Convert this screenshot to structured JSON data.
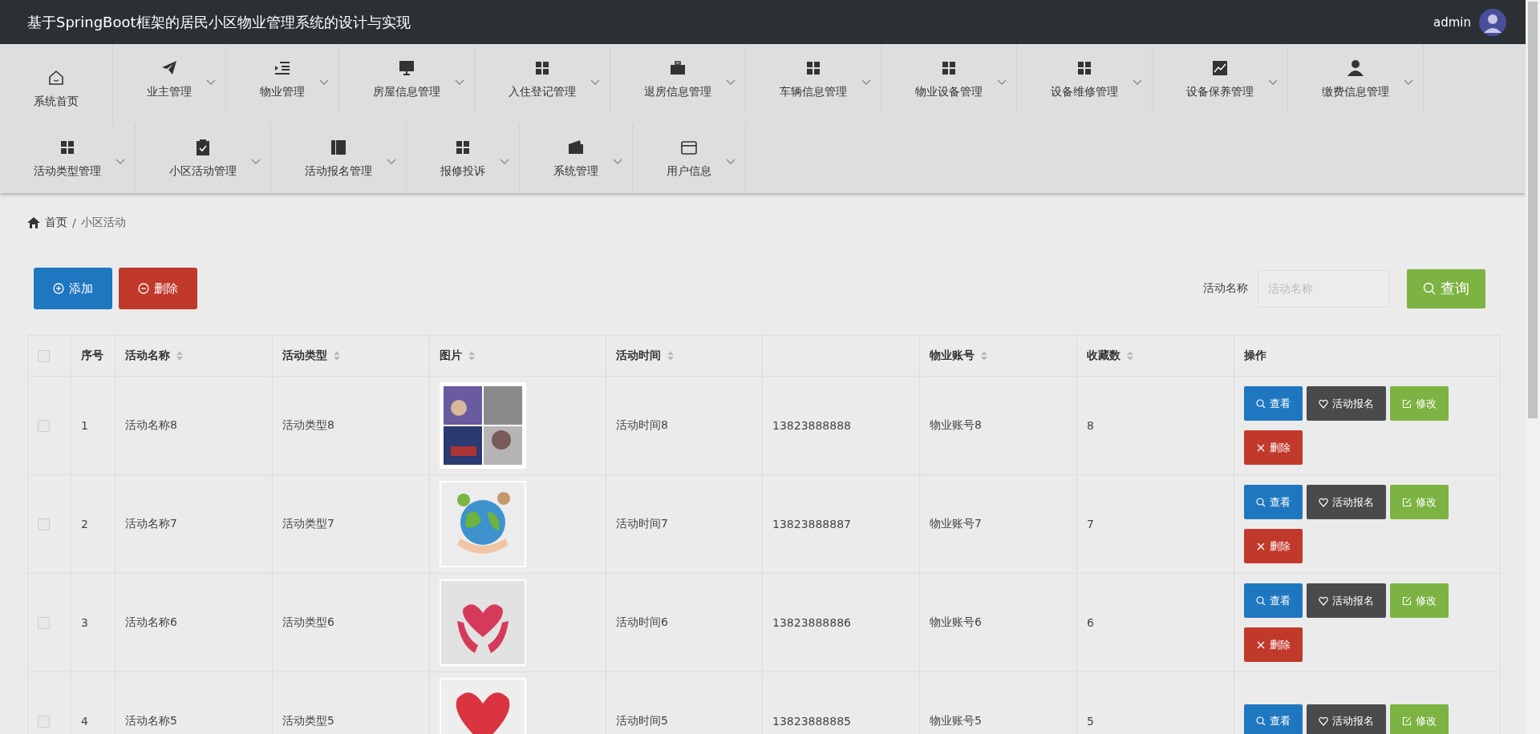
{
  "header": {
    "title": "基于SpringBoot框架的居民小区物业管理系统的设计与实现",
    "user": "admin"
  },
  "nav": [
    {
      "label": "系统首页",
      "has_dropdown": false
    },
    {
      "label": "业主管理",
      "has_dropdown": true
    },
    {
      "label": "物业管理",
      "has_dropdown": true
    },
    {
      "label": "房屋信息管理",
      "has_dropdown": true
    },
    {
      "label": "入住登记管理",
      "has_dropdown": true
    },
    {
      "label": "退房信息管理",
      "has_dropdown": true
    },
    {
      "label": "车辆信息管理",
      "has_dropdown": true
    },
    {
      "label": "物业设备管理",
      "has_dropdown": true
    },
    {
      "label": "设备维修管理",
      "has_dropdown": true
    },
    {
      "label": "设备保养管理",
      "has_dropdown": true
    },
    {
      "label": "缴费信息管理",
      "has_dropdown": true
    },
    {
      "label": "活动类型管理",
      "has_dropdown": true
    },
    {
      "label": "小区活动管理",
      "has_dropdown": true
    },
    {
      "label": "活动报名管理",
      "has_dropdown": true
    },
    {
      "label": "报修投诉",
      "has_dropdown": true
    },
    {
      "label": "系统管理",
      "has_dropdown": true
    },
    {
      "label": "用户信息",
      "has_dropdown": true
    }
  ],
  "breadcrumb": {
    "items": [
      "首页",
      "小区活动"
    ],
    "separator": "/"
  },
  "toolbar": {
    "buttons": [
      {
        "label": "添加",
        "kind": "add"
      },
      {
        "label": "删除",
        "kind": "delete"
      }
    ],
    "search": {
      "label": "活动名称",
      "placeholder": "活动名称",
      "button": "查询"
    }
  },
  "table": {
    "select_all": {
      "checked": false
    },
    "columns": [
      {
        "label": "序号",
        "sortable": false
      },
      {
        "label": "活动名称",
        "sortable": true
      },
      {
        "label": "活动类型",
        "sortable": true
      },
      {
        "label": "图片",
        "sortable": true
      },
      {
        "label": "活动时间",
        "sortable": true
      },
      {
        "sortable": false
      },
      {
        "label": "物业账号",
        "sortable": true
      },
      {
        "label": "收藏数",
        "sortable": true
      },
      {
        "label": "操作",
        "sortable": false
      }
    ],
    "rows": [
      {
        "checked": false,
        "cells": [
          "1",
          "活动名称8",
          "活动类型8",
          null,
          "活动时间8",
          "13823888888",
          "物业账号8",
          "8"
        ],
        "image": {
          "kind": "picture"
        },
        "actions": [
          {
            "label": "查看",
            "kind": "view"
          },
          {
            "label": "活动报名",
            "kind": "signup"
          },
          {
            "label": "修改",
            "kind": "edit"
          },
          {
            "label": "删除",
            "kind": "delete"
          }
        ]
      },
      {
        "checked": false,
        "cells": [
          "2",
          "活动名称7",
          "活动类型7",
          null,
          "活动时间7",
          "13823888887",
          "物业账号7",
          "7"
        ],
        "image": {
          "kind": "picture"
        },
        "actions": [
          {
            "label": "查看",
            "kind": "view"
          },
          {
            "label": "活动报名",
            "kind": "signup"
          },
          {
            "label": "修改",
            "kind": "edit"
          },
          {
            "label": "删除",
            "kind": "delete"
          }
        ]
      },
      {
        "checked": false,
        "cells": [
          "3",
          "活动名称6",
          "活动类型6",
          null,
          "活动时间6",
          "13823888886",
          "物业账号6",
          "6"
        ],
        "image": {
          "kind": "picture"
        },
        "actions": [
          {
            "label": "查看",
            "kind": "view"
          },
          {
            "label": "活动报名",
            "kind": "signup"
          },
          {
            "label": "修改",
            "kind": "edit"
          },
          {
            "label": "删除",
            "kind": "delete"
          }
        ]
      },
      {
        "checked": false,
        "cells": [
          "4",
          "活动名称5",
          "活动类型5",
          null,
          "活动时间5",
          "13823888885",
          "物业账号5",
          "5"
        ],
        "image": {
          "kind": "picture"
        },
        "actions": [
          {
            "label": "查看",
            "kind": "view"
          },
          {
            "label": "活动报名",
            "kind": "signup"
          },
          {
            "label": "修改",
            "kind": "edit"
          }
        ]
      }
    ]
  }
}
